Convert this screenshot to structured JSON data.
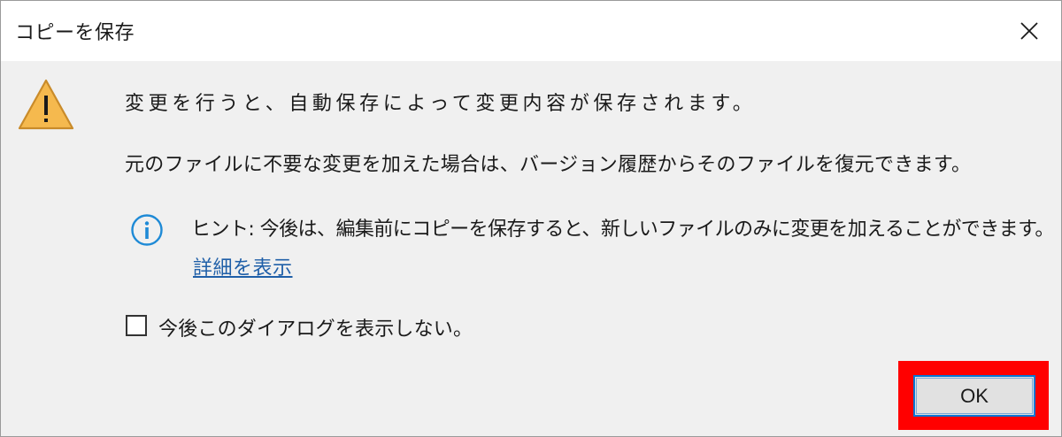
{
  "window": {
    "title": "コピーを保存",
    "close_icon": "close-icon"
  },
  "message": {
    "warning_icon": "warning-icon",
    "line1": "変更を行うと、自動保存によって変更内容が保存されます。",
    "line2": "元のファイルに不要な変更を加えた場合は、バージョン履歴からそのファイルを復元できます。"
  },
  "hint": {
    "info_icon": "info-icon",
    "text": "ヒント: 今後は、編集前にコピーを保存すると、新しいファイルのみに変更を加えることができます。",
    "link_label": "詳細を表示"
  },
  "checkbox": {
    "label": "今後このダイアログを表示しない。",
    "checked": false
  },
  "buttons": {
    "ok_label": "OK"
  },
  "colors": {
    "warning_fill": "#f5b94e",
    "info_blue": "#1e8ad6",
    "link": "#1f5fa8",
    "highlight": "#ff0000",
    "button_border": "#0078d7"
  }
}
